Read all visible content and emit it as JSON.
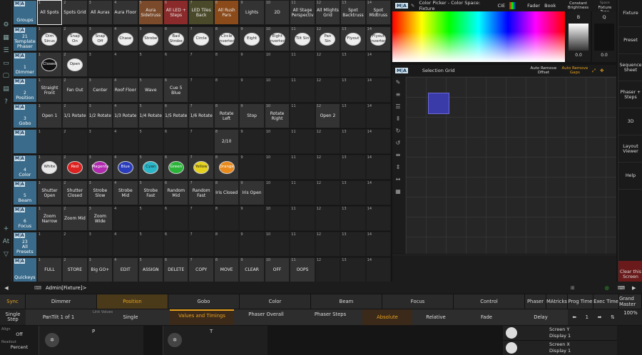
{
  "top_bar": {
    "badge": "M|A",
    "title": "Color Picker - Color Space: Fixture",
    "cie": "CIE",
    "fader": "Fader",
    "book": "Book",
    "const_bright": "Constant Brightness",
    "fixture_type_top": "RGB HSB Space",
    "fixture_type": "Fixture Type",
    "b_label": "B",
    "q_label": "Q",
    "zero1": "0.0",
    "zero2": "0.0"
  },
  "left_sidebar": {
    "icons": [
      "gear-icon",
      "layout-icon",
      "list-icon",
      "window-icon",
      "monitor-icon",
      "clipboard-icon",
      "help-icon",
      "plus-icon"
    ],
    "at_label": "At",
    "filter_label": "▽"
  },
  "right_sidebar": [
    "Fixture",
    "Preset",
    "Sequence Sheet",
    "Phaser + Steps",
    "3D",
    "Layout Viewer",
    "Help",
    "Clear this Screen"
  ],
  "rows": [
    {
      "num": "",
      "name": "Groups",
      "cells": [
        "All Spots",
        "Spots Grid",
        "All Auras",
        "Aura Floor",
        "Aura Sidetruss",
        "All LED + Steps",
        "LED Tiles Back",
        "All Rush Pars",
        "Lights",
        "2D",
        "All Stage Perspectiv",
        "All Mlights Grid",
        "Spot Backtruss",
        "Spot Midtruss"
      ]
    },
    {
      "num": "21",
      "name": "Template Phaser",
      "cells": [
        "Dim Sinus",
        "Snap On",
        "Snap Off",
        "Chase",
        "Strobe",
        "Bad Strobe",
        "Circle",
        "Circle Inverted",
        "Eight",
        "Eight Inverted",
        "Tilt Sin",
        "Pan Sin",
        "Flyout",
        "Flyout Inverted"
      ]
    },
    {
      "num": "1",
      "name": "Dimmer",
      "cells": [
        "Closed",
        "Open",
        "",
        "",
        "",
        "",
        "",
        "",
        "",
        "",
        "",
        "",
        "",
        ""
      ]
    },
    {
      "num": "2",
      "name": "Position",
      "cells": [
        "Straight Front",
        "Fan Out",
        "Center",
        "Roof Floor",
        "Wave",
        "Cue 5 Blue",
        "",
        "",
        "",
        "",
        "",
        "",
        "",
        ""
      ]
    },
    {
      "num": "3",
      "name": "Gobo",
      "cells": [
        "Open 1",
        "1/1 Rotate",
        "1/2 Rotate",
        "1/3 Rotate",
        "1/4 Rotate",
        "1/5 Rotate",
        "1/6 Rotate",
        "Rotate Left",
        "Stop",
        "Rotate Right",
        "",
        "Open 2",
        "",
        ""
      ]
    },
    {
      "num": "",
      "name": "",
      "cells": [
        "",
        "",
        "",
        "",
        "",
        "",
        "",
        "2/10",
        "",
        "",
        "",
        "",
        "",
        ""
      ]
    },
    {
      "num": "4",
      "name": "Color",
      "cells": [
        "White",
        "Red",
        "Magenta",
        "Blue",
        "Cyan",
        "Green",
        "Yellow",
        "Orange",
        "",
        "",
        "",
        "",
        "",
        ""
      ]
    },
    {
      "num": "5",
      "name": "Beam",
      "cells": [
        "Shutter Open",
        "Shutter Closed",
        "Strobe Slow",
        "Strobe Mid",
        "Strobe Fast",
        "Random Mid",
        "Random Fast",
        "Iris Closed",
        "Iris Open",
        "",
        "",
        "",
        "",
        ""
      ]
    },
    {
      "num": "6",
      "name": "Focus",
      "cells": [
        "Zoom Narrow",
        "Zoom Mid",
        "Zoom Wide",
        "",
        "",
        "",
        "",
        "",
        "",
        "",
        "",
        "",
        "",
        ""
      ]
    },
    {
      "num": "23",
      "name": "All Presets",
      "cells": [
        "",
        "",
        "",
        "",
        "",
        "",
        "",
        "",
        "",
        "",
        "",
        "",
        "",
        ""
      ]
    },
    {
      "num": "",
      "name": "Quickeys",
      "cells": [
        "FULL",
        "STORE",
        "Big GO+",
        "EDIT",
        "ASSIGN",
        "DELETE",
        "COPY",
        "MOVE",
        "CLEAR",
        "OFF",
        "OOPS",
        "",
        "",
        ""
      ]
    }
  ],
  "colors": {
    "White": "#e8e8e8",
    "Red": "#d22",
    "Magenta": "#b22ab0",
    "Blue": "#2a3dbd",
    "Cyan": "#2ab6c8",
    "Green": "#2cb43a",
    "Yellow": "#e5d21e",
    "Orange": "#e88a1e"
  },
  "selection_grid": {
    "badge": "M|A",
    "title": "Selection Grid",
    "auto_offset": "Auto Remove Offset",
    "auto_gaps": "Auto Remove Gaps"
  },
  "cmdline": {
    "text": "Admin[Fixture]>"
  },
  "features": [
    "Sync",
    "Dimmer",
    "Position",
    "Gobo",
    "Color",
    "Beam",
    "Focus",
    "Control",
    "Phaser",
    "MAtricks",
    "Prog Time",
    "Exec Time",
    "Grand Master"
  ],
  "sub": {
    "single_step": "Single Step",
    "pantilt": "PanTilt 1 of 1",
    "link_values_label": "Link Values",
    "link_values": "Single",
    "values_timings": "Values and Timings",
    "phaser_overall": "Phaser Overall",
    "phaser_steps": "Phaser Steps",
    "absolute": "Absolute",
    "relative": "Relative",
    "fade": "Fade",
    "delay": "Delay",
    "page": "1",
    "grand_pct": "100%"
  },
  "enc": {
    "align_label": "Align",
    "align_val": "Off",
    "readout_label": "Readout",
    "readout_val": "Percent",
    "p_label": "P",
    "t_label": "T",
    "sy": "Screen Y",
    "d1": "Display 1",
    "sx": "Screen X",
    "d2": "Display 1"
  }
}
